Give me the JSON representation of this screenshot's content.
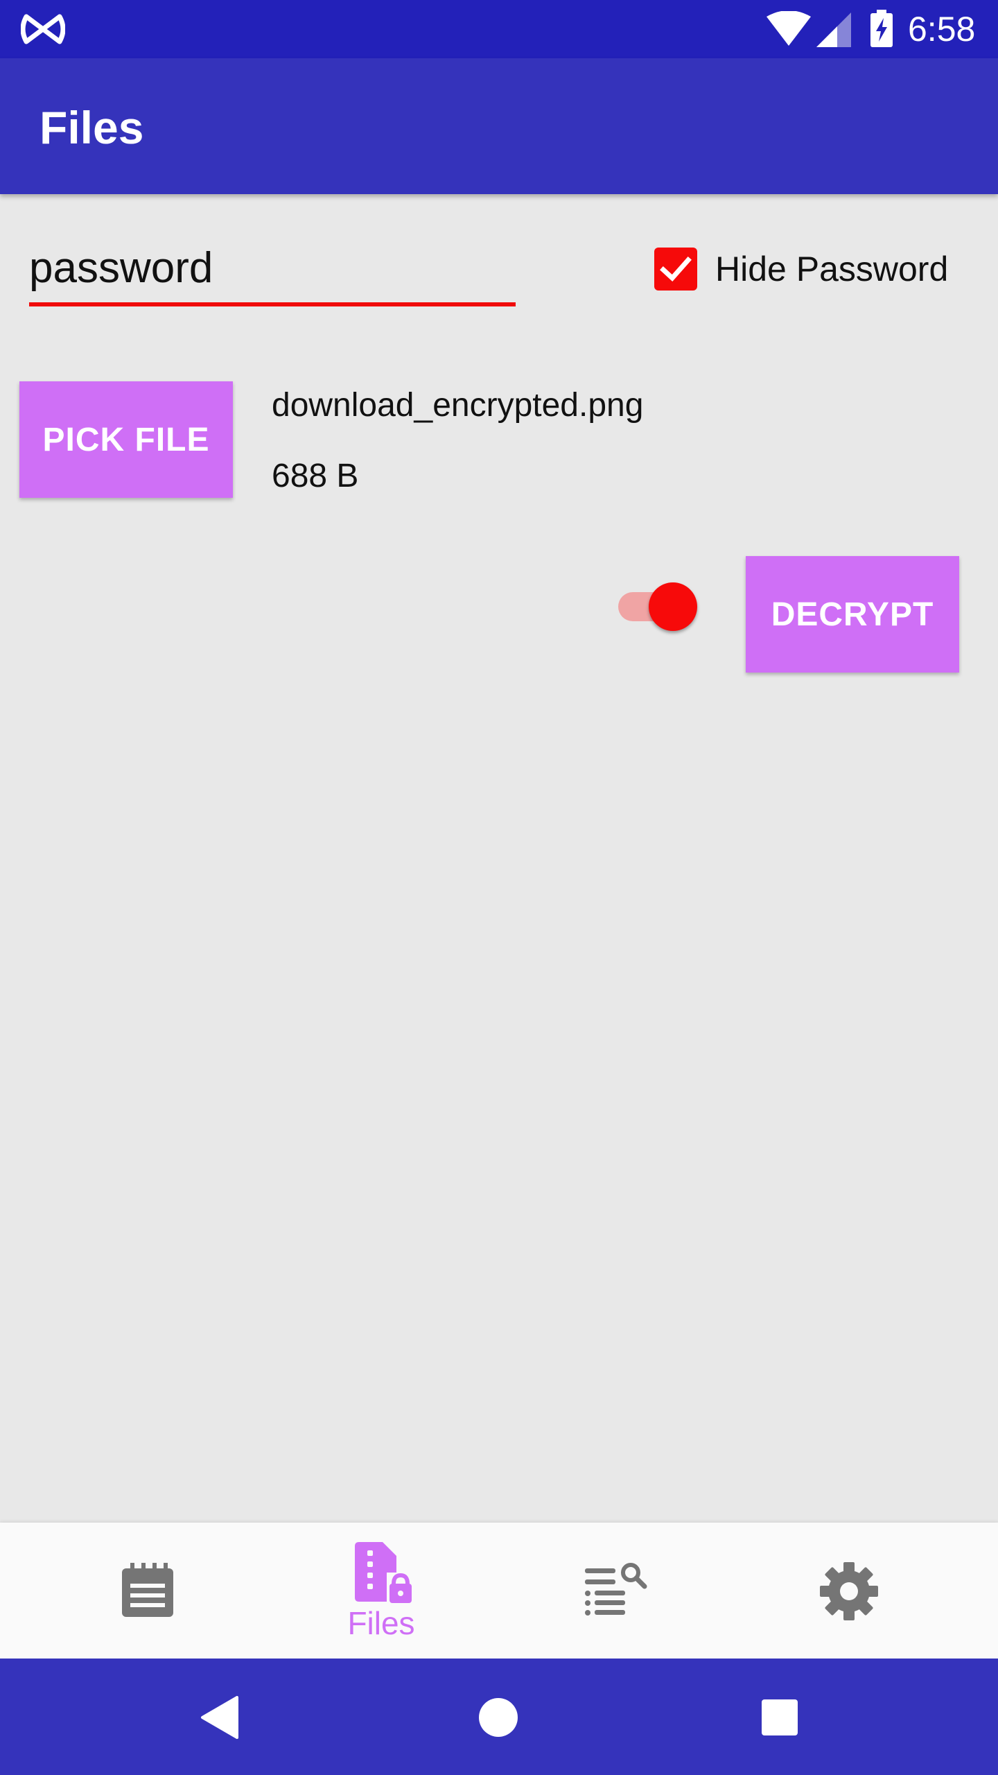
{
  "status_bar": {
    "time": "6:58",
    "icons": [
      "app-notification-icon",
      "wifi-icon",
      "cell-signal-icon",
      "battery-charging-icon"
    ]
  },
  "app_bar": {
    "title": "Files"
  },
  "password_field": {
    "value": "password",
    "accent_color": "#f00a0a"
  },
  "hide_password": {
    "label": "Hide Password",
    "checked": true
  },
  "file": {
    "pick_button_label": "PICK FILE",
    "name": "download_encrypted.png",
    "size": "688 B"
  },
  "mode_switch": {
    "on": true
  },
  "decrypt_button_label": "DECRYPT",
  "bottom_nav": {
    "items": [
      {
        "icon": "notes-icon",
        "label": "",
        "selected": false
      },
      {
        "icon": "lock-file-icon",
        "label": "Files",
        "selected": true
      },
      {
        "icon": "list-search-icon",
        "label": "",
        "selected": false
      },
      {
        "icon": "gear-icon",
        "label": "",
        "selected": false
      }
    ]
  },
  "system_nav": {
    "icons": [
      "back-icon",
      "home-icon",
      "recents-icon"
    ]
  },
  "colors": {
    "status_bar": "#2321b9",
    "app_bar": "#3533bb",
    "button": "#cf6ff6",
    "accent": "#f60a0a",
    "background": "#e8e8e8"
  }
}
